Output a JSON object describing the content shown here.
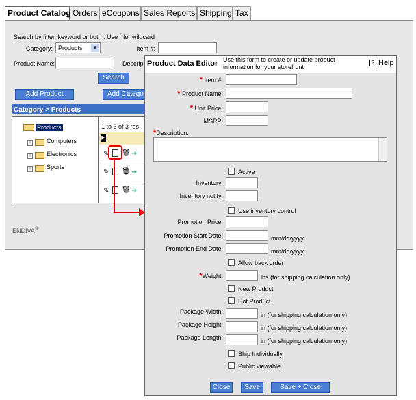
{
  "tabs": [
    "Product Catalog",
    "Orders",
    "eCoupons",
    "Sales Reports",
    "Shipping",
    "Tax"
  ],
  "search": {
    "hint_prefix": "Search by filter, keyword or both : Use",
    "hint_star": "*",
    "hint_suffix": "for wildcard",
    "category_label": "Category:",
    "category_value": "Products",
    "item_label": "Item #:",
    "name_label": "Product Name:",
    "desc_label": "Descrip",
    "search_button": "Search"
  },
  "toolbar": {
    "add_product": "Add Product",
    "add_category": "Add Categor"
  },
  "breadcrumb": "Category > Products",
  "tree": {
    "root": "Products",
    "children": [
      "Computers",
      "Electronics",
      "Sports"
    ]
  },
  "results": {
    "count_text": "1 to 3 of 3 res"
  },
  "footer": {
    "brand": "ENDIVA",
    "reg": "®"
  },
  "editor": {
    "title": "Product Data Editor",
    "description": "Use this form to create or update product information for your storefront",
    "help": "Help",
    "help_icon": "?",
    "required_mark": "*",
    "fields": {
      "item": "Item #:",
      "name": "Product Name:",
      "unit_price": "Unit Price:",
      "msrp": "MSRP:",
      "description": "Description:",
      "active": "Active",
      "inventory": "Inventory:",
      "inventory_notify": "Inventory notify:",
      "use_inventory": "Use inventory control",
      "promo_price": "Promotion Price:",
      "promo_start": "Promotion Start Date:",
      "promo_end": "Promotion End Date:",
      "date_format": "mm/dd/yyyy",
      "allow_backorder": "Allow back order",
      "weight": "Weight:",
      "weight_note": "lbs (for shipping calculation only)",
      "new_product": "New Product",
      "hot_product": "Hot Product",
      "pkg_width": "Package Width:",
      "pkg_height": "Package Height:",
      "pkg_length": "Package Length:",
      "dim_note": "in (for shipping calculation only)",
      "ship_individually": "Ship Individually",
      "public_viewable": "Public viewable"
    },
    "buttons": {
      "close": "Close",
      "save": "Save",
      "save_close": "Save + Close"
    }
  },
  "colors": {
    "accent": "#4b7fd5",
    "callout": "#e00000",
    "header_bg": "#3f6fc6"
  }
}
